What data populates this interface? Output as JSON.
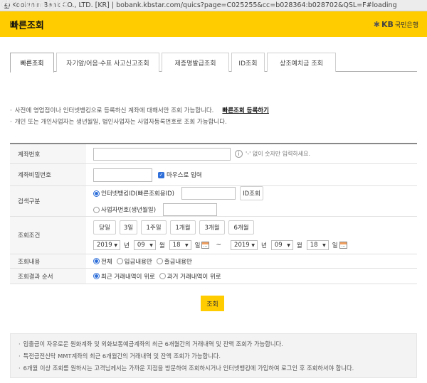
{
  "browser": {
    "url_text": "Kookmin Bank CO., LTD. [KR] | bobank.kbstar.com/quics?page=C025255&cc=b028364:b028702&QSL=F#loading",
    "watermark": "dcrumble"
  },
  "header": {
    "title": "빠른조회",
    "logo_mark": "KB",
    "logo_text": "국민은행"
  },
  "tabs": [
    {
      "label": "빠른조회",
      "active": true
    },
    {
      "label": "자기앞/어음·수표 사고신고조회"
    },
    {
      "label": "제증명발급조회"
    },
    {
      "label": "ID조회"
    },
    {
      "label": "상조예치금 조회"
    }
  ],
  "notes": {
    "line1": "사전에 영업점이나 인터넷뱅킹으로 등록하신 계좌에 대해서만 조회 가능합니다.",
    "link": "빠른조회 등록하기",
    "line2": "개인 또는 개인사업자는 생년월일, 법인사업자는 사업자등록번호로 조회 가능합니다."
  },
  "form": {
    "account": {
      "label": "계좌번호",
      "hint": "'-' 없이 숫자만 입력하세요."
    },
    "password": {
      "label": "계좌비밀번호",
      "mouse_label": "마우스로 입력"
    },
    "search_type": {
      "label": "검색구분",
      "option1": "인터넷뱅킹ID(빠른조회용ID)",
      "id_button": "ID조회",
      "option2": "사업자번호(생년월일)"
    },
    "period": {
      "label": "조회조건",
      "buttons": [
        "당일",
        "3일",
        "1주일",
        "1개월",
        "3개월",
        "6개월"
      ],
      "from": {
        "year": "2019",
        "month": "09",
        "day": "18"
      },
      "to": {
        "year": "2019",
        "month": "09",
        "day": "18"
      },
      "unit_year": "년",
      "unit_month": "월",
      "unit_day": "일",
      "tilde": "~"
    },
    "content": {
      "label": "조회내용",
      "options": [
        "전체",
        "입금내용만",
        "출금내용만"
      ]
    },
    "order": {
      "label": "조회결과 순서",
      "options": [
        "최근 거래내역이 위로",
        "과거 거래내역이 위로"
      ]
    }
  },
  "search_button": "조회",
  "bottom_notes": [
    "입출금이 자유로운 원화계좌 및 외화보통예금계좌의 최근 6개월간의 거래내역 및 잔액 조회가 가능합니다.",
    "특전금전신탁 MMT계좌의 최근 6개월간의 거래내역 및 잔액 조회가 가능합니다.",
    "6개월 이상 조회를 원하시는 고객님께서는 가까운 지점을 방문하여 조회하시거나 인터넷뱅킹에 가입하여 로그인 후 조회하셔야 합니다."
  ],
  "colors": {
    "accent": "#ffcc00",
    "radio": "#2f6fd9"
  }
}
